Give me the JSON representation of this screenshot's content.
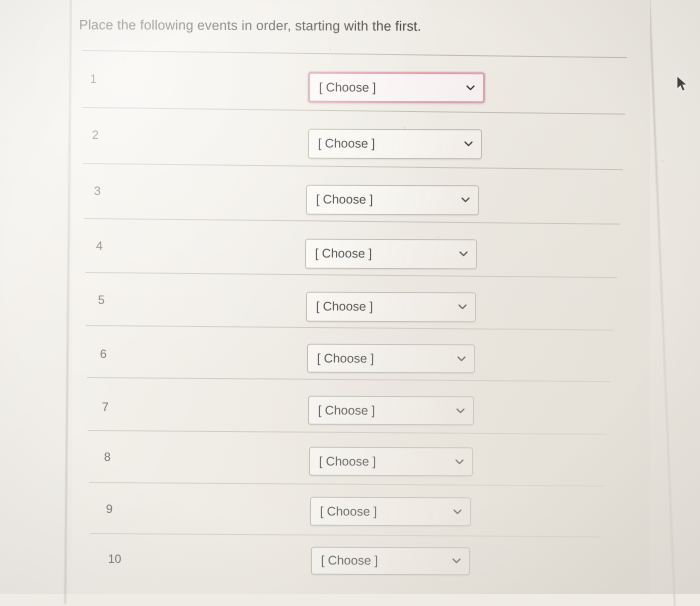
{
  "prompt": {
    "text": "Place the following events in order, starting with the first."
  },
  "colors": {
    "page_background": "#efece6",
    "screen_background": "#f1eee8",
    "text": "#3b3a38",
    "rule": "#9e9a92",
    "select_border": "#b0aca4",
    "focus_border": "#d7a2ac",
    "row_number": "#55524e"
  },
  "ordering_rows": [
    {
      "number": "1",
      "select": {
        "value": "[ Choose ]",
        "focused": true,
        "caret_icon": "chevron-down-icon"
      }
    },
    {
      "number": "2",
      "select": {
        "value": "[ Choose ]",
        "focused": false,
        "caret_icon": "chevron-down-icon"
      }
    },
    {
      "number": "3",
      "select": {
        "value": "[ Choose ]",
        "focused": false,
        "caret_icon": "chevron-down-icon"
      }
    },
    {
      "number": "4",
      "select": {
        "value": "[ Choose ]",
        "focused": false,
        "caret_icon": "chevron-down-icon"
      }
    },
    {
      "number": "5",
      "select": {
        "value": "[ Choose ]",
        "focused": false,
        "caret_icon": "chevron-down-icon"
      }
    },
    {
      "number": "6",
      "select": {
        "value": "[ Choose ]",
        "focused": false,
        "caret_icon": "chevron-down-icon"
      }
    },
    {
      "number": "7",
      "select": {
        "value": "[ Choose ]",
        "focused": false,
        "caret_icon": "chevron-down-icon"
      }
    },
    {
      "number": "8",
      "select": {
        "value": "[ Choose ]",
        "focused": false,
        "caret_icon": "chevron-down-icon"
      }
    },
    {
      "number": "9",
      "select": {
        "value": "[ Choose ]",
        "focused": false,
        "caret_icon": "chevron-down-icon"
      }
    },
    {
      "number": "10",
      "select": {
        "value": "[ Choose ]",
        "focused": false,
        "caret_icon": "chevron-down-icon"
      }
    }
  ],
  "pointer": {
    "icon": "mouse-cursor-arrow"
  }
}
